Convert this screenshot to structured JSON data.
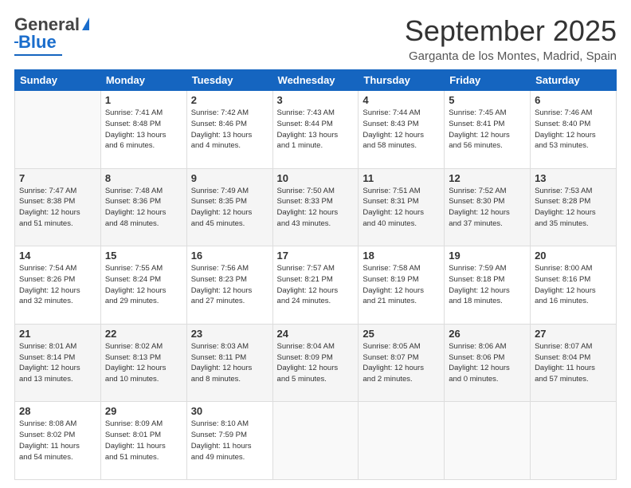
{
  "header": {
    "logo_general": "General",
    "logo_blue": "Blue",
    "month_title": "September 2025",
    "location": "Garganta de los Montes, Madrid, Spain"
  },
  "columns": [
    "Sunday",
    "Monday",
    "Tuesday",
    "Wednesday",
    "Thursday",
    "Friday",
    "Saturday"
  ],
  "weeks": [
    [
      {
        "day": "",
        "info": ""
      },
      {
        "day": "1",
        "info": "Sunrise: 7:41 AM\nSunset: 8:48 PM\nDaylight: 13 hours\nand 6 minutes."
      },
      {
        "day": "2",
        "info": "Sunrise: 7:42 AM\nSunset: 8:46 PM\nDaylight: 13 hours\nand 4 minutes."
      },
      {
        "day": "3",
        "info": "Sunrise: 7:43 AM\nSunset: 8:44 PM\nDaylight: 13 hours\nand 1 minute."
      },
      {
        "day": "4",
        "info": "Sunrise: 7:44 AM\nSunset: 8:43 PM\nDaylight: 12 hours\nand 58 minutes."
      },
      {
        "day": "5",
        "info": "Sunrise: 7:45 AM\nSunset: 8:41 PM\nDaylight: 12 hours\nand 56 minutes."
      },
      {
        "day": "6",
        "info": "Sunrise: 7:46 AM\nSunset: 8:40 PM\nDaylight: 12 hours\nand 53 minutes."
      }
    ],
    [
      {
        "day": "7",
        "info": "Sunrise: 7:47 AM\nSunset: 8:38 PM\nDaylight: 12 hours\nand 51 minutes."
      },
      {
        "day": "8",
        "info": "Sunrise: 7:48 AM\nSunset: 8:36 PM\nDaylight: 12 hours\nand 48 minutes."
      },
      {
        "day": "9",
        "info": "Sunrise: 7:49 AM\nSunset: 8:35 PM\nDaylight: 12 hours\nand 45 minutes."
      },
      {
        "day": "10",
        "info": "Sunrise: 7:50 AM\nSunset: 8:33 PM\nDaylight: 12 hours\nand 43 minutes."
      },
      {
        "day": "11",
        "info": "Sunrise: 7:51 AM\nSunset: 8:31 PM\nDaylight: 12 hours\nand 40 minutes."
      },
      {
        "day": "12",
        "info": "Sunrise: 7:52 AM\nSunset: 8:30 PM\nDaylight: 12 hours\nand 37 minutes."
      },
      {
        "day": "13",
        "info": "Sunrise: 7:53 AM\nSunset: 8:28 PM\nDaylight: 12 hours\nand 35 minutes."
      }
    ],
    [
      {
        "day": "14",
        "info": "Sunrise: 7:54 AM\nSunset: 8:26 PM\nDaylight: 12 hours\nand 32 minutes."
      },
      {
        "day": "15",
        "info": "Sunrise: 7:55 AM\nSunset: 8:24 PM\nDaylight: 12 hours\nand 29 minutes."
      },
      {
        "day": "16",
        "info": "Sunrise: 7:56 AM\nSunset: 8:23 PM\nDaylight: 12 hours\nand 27 minutes."
      },
      {
        "day": "17",
        "info": "Sunrise: 7:57 AM\nSunset: 8:21 PM\nDaylight: 12 hours\nand 24 minutes."
      },
      {
        "day": "18",
        "info": "Sunrise: 7:58 AM\nSunset: 8:19 PM\nDaylight: 12 hours\nand 21 minutes."
      },
      {
        "day": "19",
        "info": "Sunrise: 7:59 AM\nSunset: 8:18 PM\nDaylight: 12 hours\nand 18 minutes."
      },
      {
        "day": "20",
        "info": "Sunrise: 8:00 AM\nSunset: 8:16 PM\nDaylight: 12 hours\nand 16 minutes."
      }
    ],
    [
      {
        "day": "21",
        "info": "Sunrise: 8:01 AM\nSunset: 8:14 PM\nDaylight: 12 hours\nand 13 minutes."
      },
      {
        "day": "22",
        "info": "Sunrise: 8:02 AM\nSunset: 8:13 PM\nDaylight: 12 hours\nand 10 minutes."
      },
      {
        "day": "23",
        "info": "Sunrise: 8:03 AM\nSunset: 8:11 PM\nDaylight: 12 hours\nand 8 minutes."
      },
      {
        "day": "24",
        "info": "Sunrise: 8:04 AM\nSunset: 8:09 PM\nDaylight: 12 hours\nand 5 minutes."
      },
      {
        "day": "25",
        "info": "Sunrise: 8:05 AM\nSunset: 8:07 PM\nDaylight: 12 hours\nand 2 minutes."
      },
      {
        "day": "26",
        "info": "Sunrise: 8:06 AM\nSunset: 8:06 PM\nDaylight: 12 hours\nand 0 minutes."
      },
      {
        "day": "27",
        "info": "Sunrise: 8:07 AM\nSunset: 8:04 PM\nDaylight: 11 hours\nand 57 minutes."
      }
    ],
    [
      {
        "day": "28",
        "info": "Sunrise: 8:08 AM\nSunset: 8:02 PM\nDaylight: 11 hours\nand 54 minutes."
      },
      {
        "day": "29",
        "info": "Sunrise: 8:09 AM\nSunset: 8:01 PM\nDaylight: 11 hours\nand 51 minutes."
      },
      {
        "day": "30",
        "info": "Sunrise: 8:10 AM\nSunset: 7:59 PM\nDaylight: 11 hours\nand 49 minutes."
      },
      {
        "day": "",
        "info": ""
      },
      {
        "day": "",
        "info": ""
      },
      {
        "day": "",
        "info": ""
      },
      {
        "day": "",
        "info": ""
      }
    ]
  ]
}
